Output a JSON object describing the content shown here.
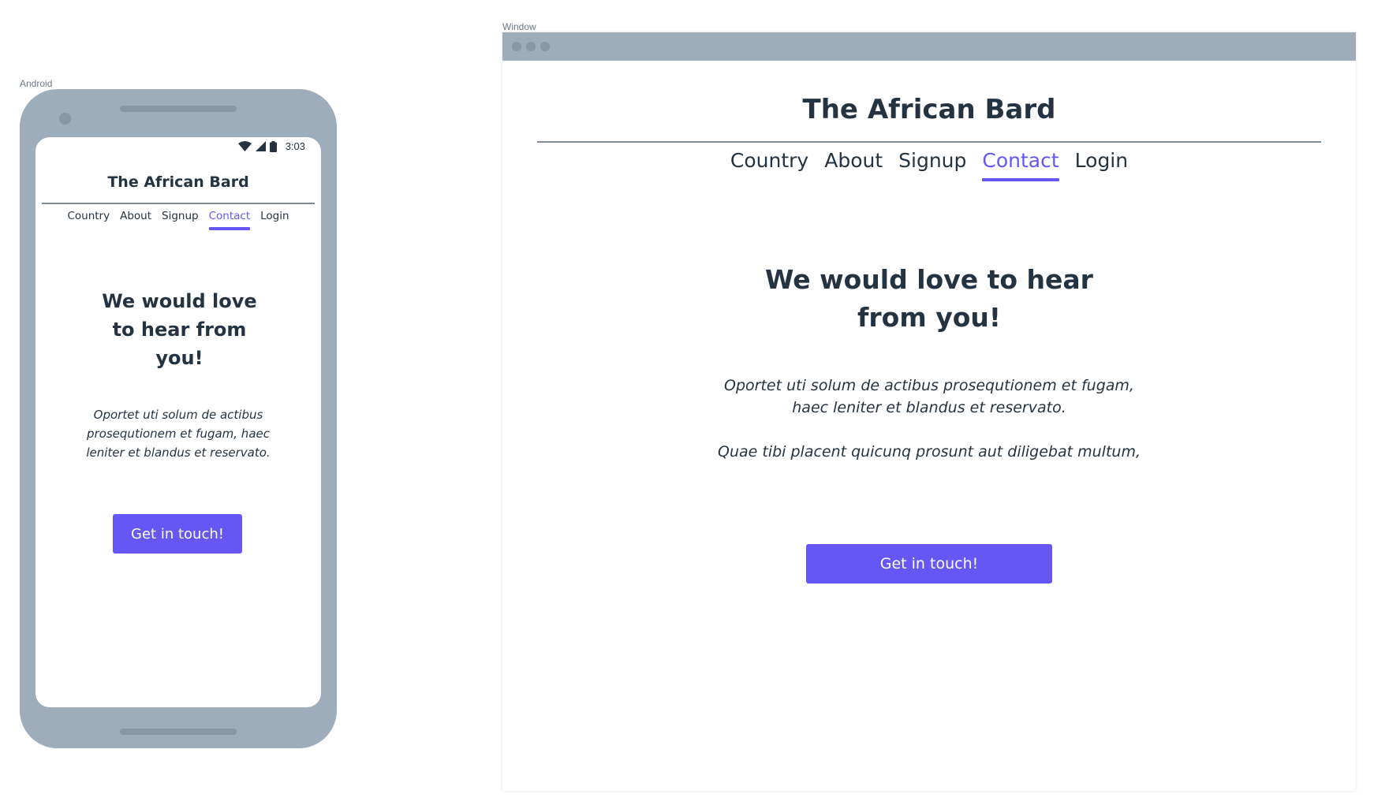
{
  "android": {
    "frame_label": "Android",
    "status_time": "3:03",
    "site_title": "The African Bard",
    "nav": [
      {
        "label": "Country",
        "active": false
      },
      {
        "label": "About",
        "active": false
      },
      {
        "label": "Signup",
        "active": false
      },
      {
        "label": "Contact",
        "active": true
      },
      {
        "label": "Login",
        "active": false
      }
    ],
    "heading_lines": [
      "We would love",
      "to hear from",
      "you!"
    ],
    "body_lines": [
      "Oportet uti solum de actibus",
      "prosequtionem et fugam, haec",
      "leniter et blandus et reservato."
    ],
    "cta_label": "Get in touch!"
  },
  "window": {
    "frame_label": "Window",
    "site_title": "The African Bard",
    "nav": [
      {
        "label": "Country",
        "active": false
      },
      {
        "label": "About",
        "active": false
      },
      {
        "label": "Signup",
        "active": false
      },
      {
        "label": "Contact",
        "active": true
      },
      {
        "label": "Login",
        "active": false
      }
    ],
    "heading_lines": [
      "We would love to hear",
      "from you!"
    ],
    "paragraph1_lines": [
      "Oportet uti solum de actibus prosequtionem et fugam,",
      "haec leniter et blandus et reservato."
    ],
    "paragraph2": "Quae tibi placent quicunq prosunt aut diligebat multum,",
    "cta_label": "Get in touch!"
  },
  "colors": {
    "accent": "#6657f4",
    "text": "#243342",
    "device_frame": "#9eadbb",
    "rule": "#7d8a96"
  },
  "icons": [
    "wifi-icon",
    "cellular-signal-icon",
    "battery-icon"
  ]
}
